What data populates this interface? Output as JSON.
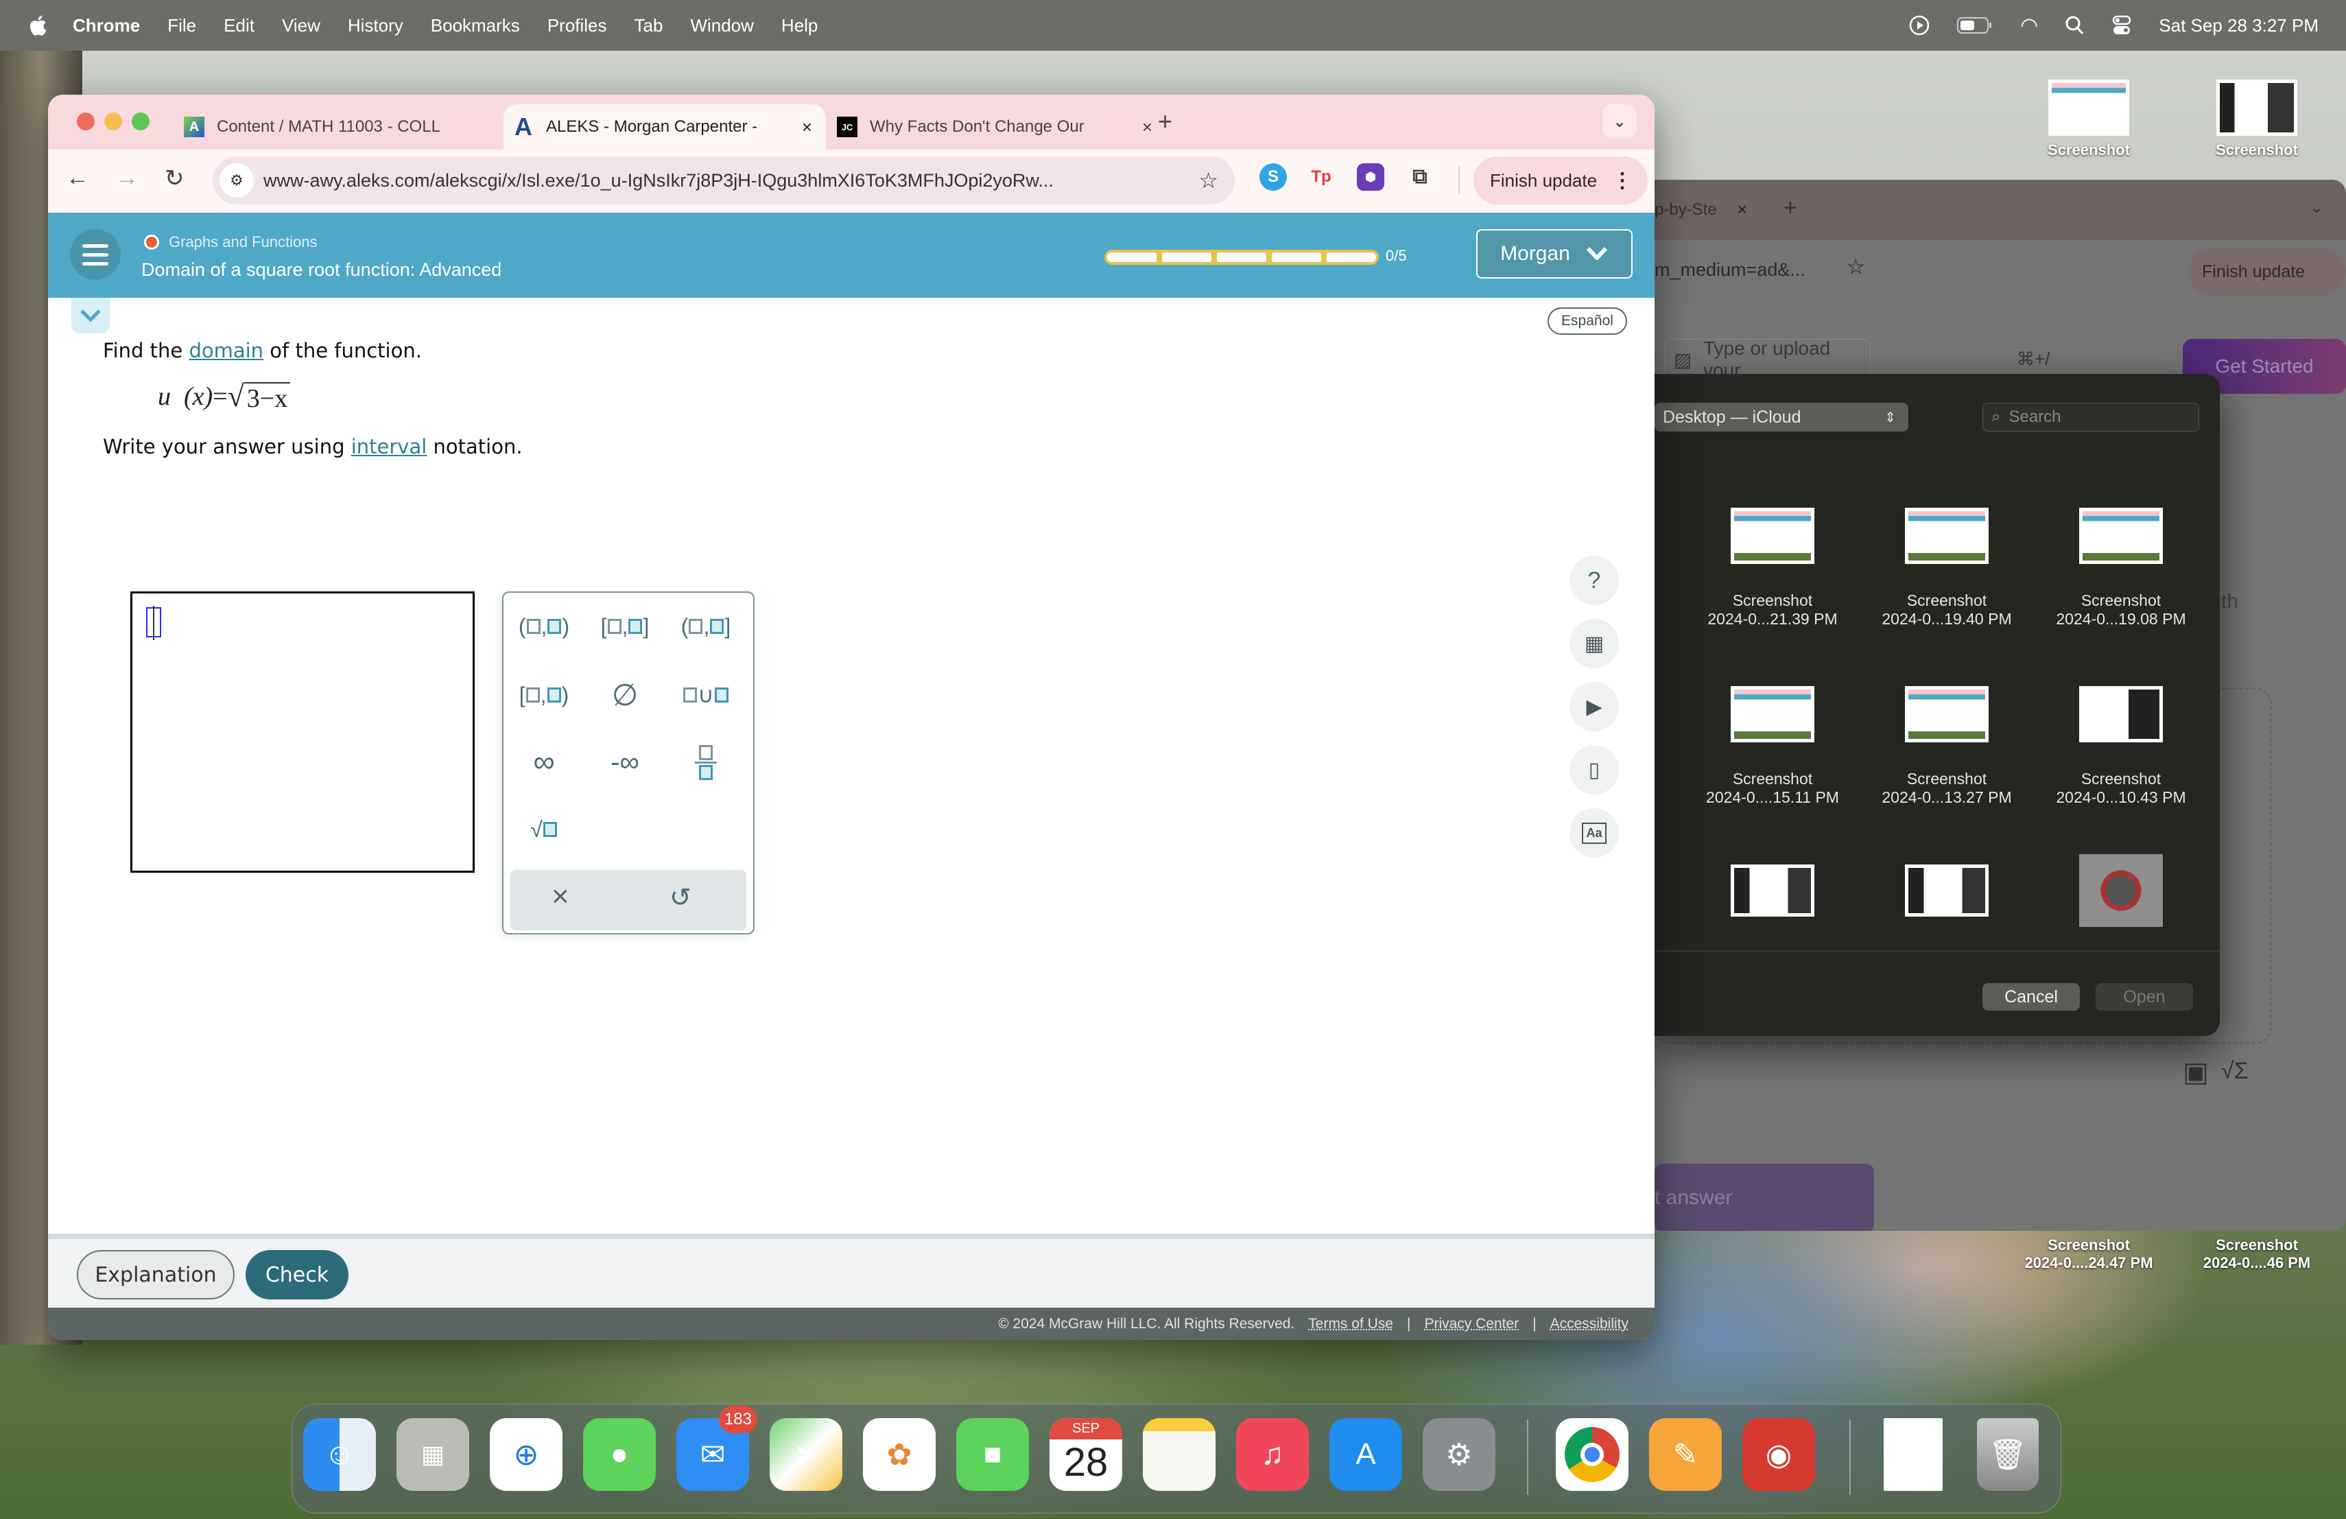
{
  "menubar": {
    "app_name": "Chrome",
    "items": [
      "File",
      "Edit",
      "View",
      "History",
      "Bookmarks",
      "Profiles",
      "Tab",
      "Window",
      "Help"
    ],
    "datetime": "Sat Sep 28  3:27 PM"
  },
  "browser": {
    "tabs": [
      {
        "label": "Content / MATH 11003 - COLL",
        "favicon": "A",
        "active": false
      },
      {
        "label": "ALEKS - Morgan Carpenter - ",
        "favicon": "A",
        "active": true
      },
      {
        "label": "Why Facts Don't Change Our",
        "favicon": "JC",
        "active": false
      }
    ],
    "url": "www-awy.aleks.com/alekscgi/x/Isl.exe/1o_u-IgNsIkr7j8P3jH-IQgu3hlmXI6ToK3MFhJOpi2yoRw...",
    "finish_update_label": "Finish update",
    "extensions": [
      "skype-icon",
      "tp-icon",
      "crystal-icon",
      "puzzle-icon"
    ]
  },
  "aleks": {
    "topic": "Graphs and Functions",
    "title": "Domain of a square root function: Advanced",
    "progress": {
      "completed": 0,
      "total": 5,
      "label": "0/5"
    },
    "user_menu_label": "Morgan",
    "language_button": "Español",
    "question": {
      "line1_pre": "Find the ",
      "line1_link": "domain",
      "line1_post": " of the function.",
      "function_name": "u",
      "function_var": "(x)",
      "equals": "=",
      "radicand": "3−x",
      "line2_pre": "Write your answer using ",
      "line2_link": "interval",
      "line2_post": " notation."
    },
    "answer_value": "",
    "keypad": {
      "keys": [
        "open-open-interval",
        "closed-closed-interval",
        "open-closed-interval",
        "closed-open-interval",
        "empty-set",
        "union",
        "infinity",
        "negative-infinity",
        "fraction",
        "square-root"
      ],
      "empty_set_symbol": "∅",
      "infinity_symbol": "∞",
      "neg_infinity_symbol": "-∞",
      "clear_symbol": "×",
      "undo_symbol": "↺"
    },
    "side_tools": [
      "help",
      "calculator-disabled",
      "video",
      "ebook",
      "dictionary"
    ],
    "help_symbol": "?",
    "explanation_label": "Explanation",
    "check_label": "Check",
    "footer": {
      "copyright": "© 2024 McGraw Hill LLC. All Rights Reserved.",
      "links": [
        "Terms of Use",
        "Privacy Center",
        "Accessibility"
      ],
      "separator": "|"
    }
  },
  "background_window": {
    "tab_fragment": "p-by-Ste",
    "url_fragment": "m_medium=ad&...",
    "finish_update_label": "Finish update",
    "input_placeholder": "Type or upload your ...",
    "shortcut": "⌘+/",
    "get_started_label": "Get Started",
    "answer_fragment": "t answer",
    "side_text": "th"
  },
  "file_dialog": {
    "location": "Desktop — iCloud",
    "search_placeholder": "Search",
    "files": [
      {
        "name": "Screenshot",
        "date": "2024-0...21.39 PM"
      },
      {
        "name": "Screenshot",
        "date": "2024-0...19.40 PM"
      },
      {
        "name": "Screenshot",
        "date": "2024-0...19.08 PM"
      },
      {
        "name": "Screenshot",
        "date": "2024-0....15.11 PM"
      },
      {
        "name": "Screenshot",
        "date": "2024-0...13.27 PM"
      },
      {
        "name": "Screenshot",
        "date": "2024-0...10.43 PM"
      }
    ],
    "cancel_label": "Cancel",
    "open_label": "Open"
  },
  "desktop_files": [
    {
      "name": "Screenshot",
      "date": ""
    },
    {
      "name": "Screenshot",
      "date": ""
    },
    {
      "name": "Screenshot",
      "date": "2024-0....24.47 PM"
    },
    {
      "name": "Screenshot",
      "date": "2024-0....46 PM"
    }
  ],
  "dock": {
    "apps": [
      "Finder",
      "Launchpad",
      "Safari",
      "Messages",
      "Mail",
      "Maps",
      "Photos",
      "FaceTime",
      "Calendar",
      "Notes",
      "Music",
      "App Store",
      "System Settings",
      "Chrome",
      "Pages",
      "Photo Booth",
      "Document",
      "Trash"
    ],
    "mail_badge": "183",
    "calendar_month": "SEP",
    "calendar_day": "28"
  },
  "colors": {
    "aleks_header": "#4fa8c7",
    "check_button": "#2d6b7c",
    "link": "#2f7f93",
    "progress": "#e6c34a",
    "tab_strip": "#f7d9de"
  }
}
